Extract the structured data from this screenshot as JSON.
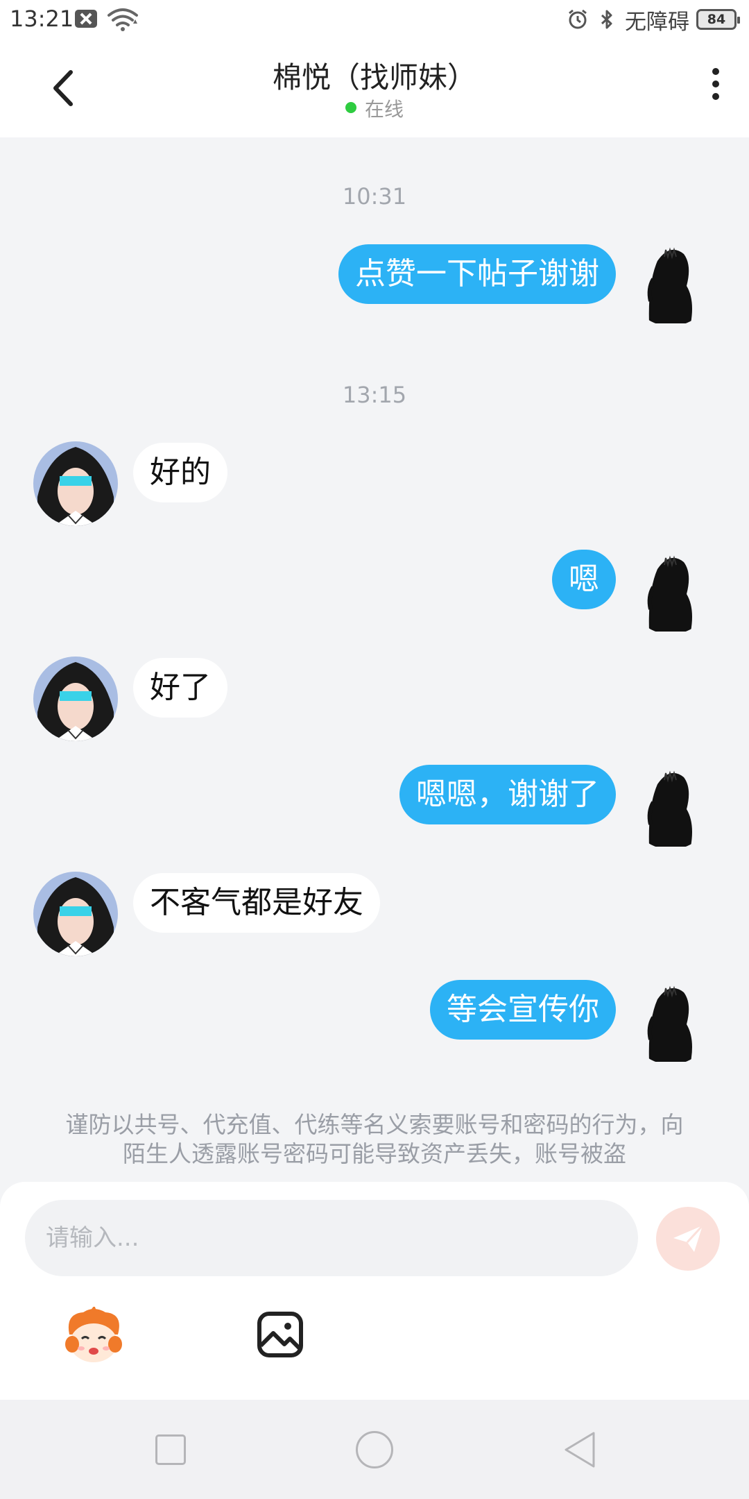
{
  "status_bar": {
    "time": "13:21",
    "accessibility_label": "无障碍",
    "battery": "84",
    "icons": [
      "notification-icon",
      "wifi-icon",
      "alarm-icon",
      "bluetooth-icon",
      "battery-icon"
    ]
  },
  "header": {
    "title": "棉悦（找师妹）",
    "status": "在线",
    "status_color": "#2ecc40",
    "icons": [
      "back-icon",
      "more-icon"
    ]
  },
  "chat": {
    "messages": [
      {
        "type": "timestamp",
        "text": "10:31"
      },
      {
        "type": "message",
        "direction": "outgoing",
        "text": "点赞一下帖子谢谢"
      },
      {
        "type": "timestamp",
        "text": "13:15"
      },
      {
        "type": "message",
        "direction": "incoming",
        "text": "好的"
      },
      {
        "type": "message",
        "direction": "outgoing",
        "text": "嗯"
      },
      {
        "type": "message",
        "direction": "incoming",
        "text": "好了"
      },
      {
        "type": "message",
        "direction": "outgoing",
        "text": "嗯嗯，谢谢了"
      },
      {
        "type": "message",
        "direction": "incoming",
        "text": "不客气都是好友"
      },
      {
        "type": "message",
        "direction": "outgoing",
        "text": "等会宣传你"
      }
    ],
    "notice": "谨防以共号、代充值、代练等名义索要账号和密码的行为，向陌生人透露账号密码可能导致资产丢失，账号被盗"
  },
  "input": {
    "placeholder": "请输入...",
    "value": "",
    "tools": [
      "emoji-icon",
      "image-icon",
      "send-icon"
    ]
  },
  "colors": {
    "outgoing_bubble": "#2cb2f5",
    "incoming_bubble": "#ffffff",
    "chat_background": "#f3f4f6",
    "send_button": "#fbe0da"
  },
  "nav_bar": {
    "icons": [
      "recent-apps-icon",
      "home-icon",
      "back-nav-icon"
    ]
  }
}
